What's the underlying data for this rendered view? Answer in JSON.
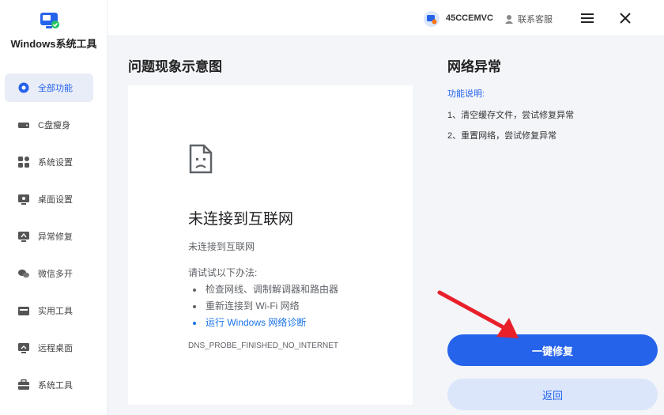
{
  "app": {
    "name": "Windows系统工具"
  },
  "sidebar": {
    "items": [
      {
        "label": "全部功能",
        "icon": "gear-icon",
        "active": true
      },
      {
        "label": "C盘瘦身",
        "icon": "drive-icon"
      },
      {
        "label": "系统设置",
        "icon": "grid-icon"
      },
      {
        "label": "桌面设置",
        "icon": "monitor-icon"
      },
      {
        "label": "异常修复",
        "icon": "repair-icon"
      },
      {
        "label": "微信多开",
        "icon": "chat-icon"
      },
      {
        "label": "实用工具",
        "icon": "toolbox-icon"
      },
      {
        "label": "远程桌面",
        "icon": "remote-icon"
      },
      {
        "label": "系统工具",
        "icon": "briefcase-icon"
      }
    ]
  },
  "topbar": {
    "user_id": "45CCEMVC",
    "support_label": "联系客服"
  },
  "left": {
    "title": "问题现象示意图",
    "preview": {
      "heading": "未连接到互联网",
      "sub": "未连接到互联网",
      "try": "请试试以下办法:",
      "tips": [
        "检查网线、调制解调器和路由器",
        "重新连接到 Wi-Fi 网络",
        "运行 Windows 网络诊断"
      ],
      "code": "DNS_PROBE_FINISHED_NO_INTERNET"
    }
  },
  "right": {
    "title": "网络异常",
    "func_label": "功能说明:",
    "func_items": [
      "1、清空缓存文件，尝试修复异常",
      "2、重置网络，尝试修复异常"
    ],
    "primary_button": "一键修复",
    "secondary_button": "返回"
  },
  "colors": {
    "accent": "#2563eb",
    "arrow": "#e8202a",
    "link": "#1a73e8"
  }
}
